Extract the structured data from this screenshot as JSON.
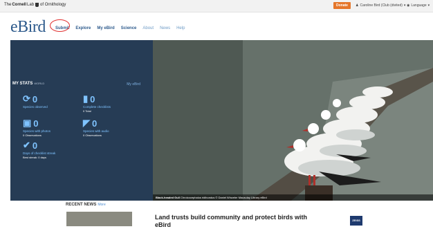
{
  "topbar": {
    "org_prefix": "The",
    "org_bold": "Cornell",
    "org_lab": "Lab",
    "org_rest": "of Ornithology",
    "donate": "Donate",
    "user": "Caroline Bird (Club (divited)",
    "language": "Language"
  },
  "nav": {
    "logo": "eBird",
    "items": [
      "Submit",
      "Explore",
      "My eBird",
      "Science",
      "About",
      "News",
      "Help"
    ]
  },
  "stats": {
    "title": "MY STATS",
    "scope": "WORLD",
    "link": "My eBird",
    "species_observed": {
      "value": "0",
      "label": "Species observed"
    },
    "complete_checklists": {
      "value": "0",
      "label": "Complete checklists",
      "sub": "0 Total"
    },
    "species_with_photos": {
      "value": "0",
      "label": "Species with photos",
      "sub": "0 Observations"
    },
    "species_with_audio": {
      "value": "0",
      "label": "Species with audio",
      "sub": "0 Observations"
    },
    "streak": {
      "value": "0",
      "label": "Days of checklist streak",
      "sub": "Best streak: 0 days"
    }
  },
  "hero": {
    "species": "Black-headed Gull",
    "scientific": "Chroicocephalus ridibundus",
    "credit": "© Daniel Winzeler",
    "library": "Macaulay Library",
    "source": "eBird"
  },
  "news": {
    "heading": "RECENT NEWS",
    "more": "More",
    "title": "Land trusts build community and protect birds with eBird",
    "sponsor": "ZEISS"
  },
  "colors": {
    "accent": "#2d5a8c",
    "panel": "#263c55",
    "stat": "#7fc3ff",
    "donate": "#e5762a"
  }
}
